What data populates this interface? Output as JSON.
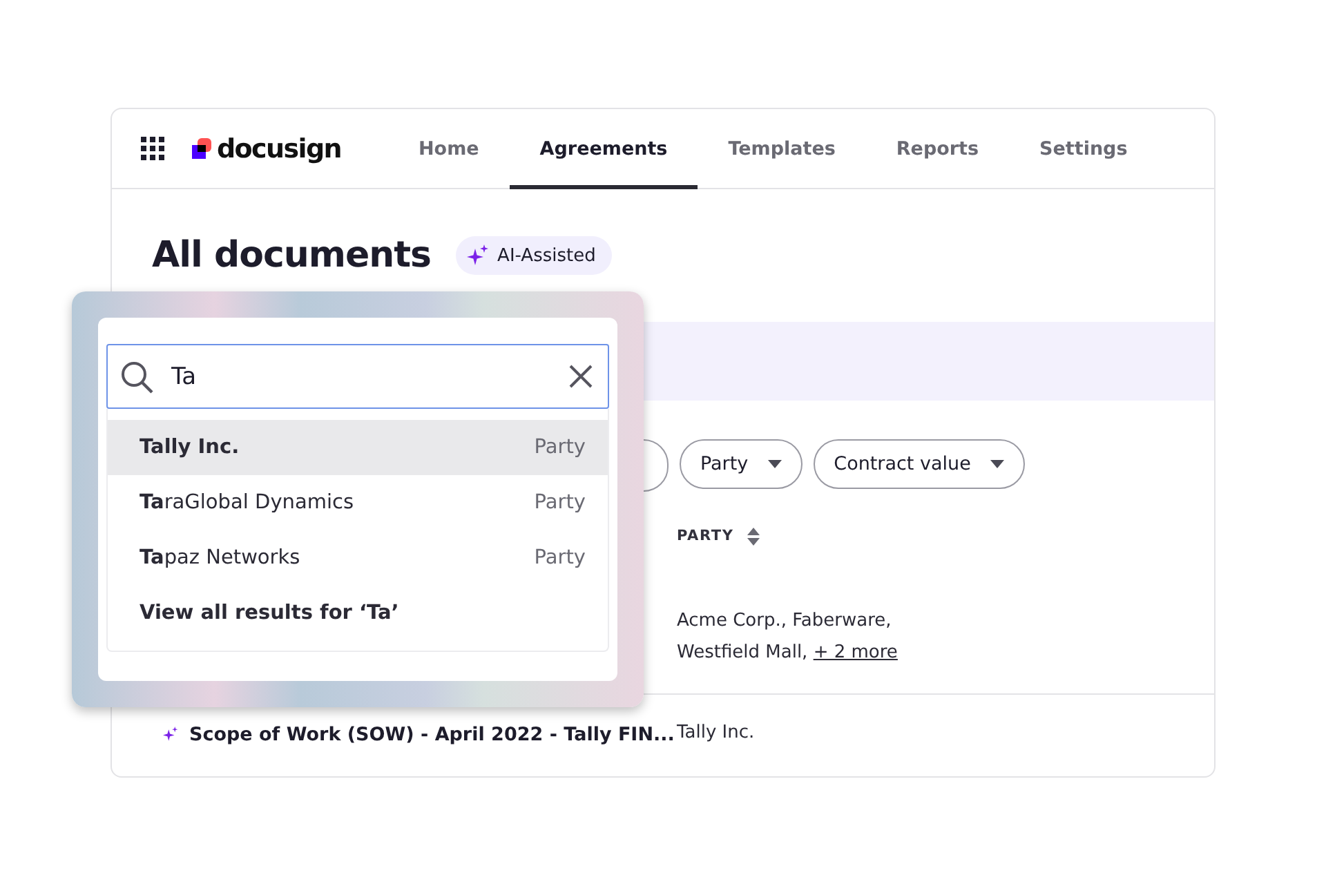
{
  "nav": {
    "logo": "docusign",
    "tabs": [
      {
        "label": "Home",
        "selected": false
      },
      {
        "label": "Agreements",
        "selected": true
      },
      {
        "label": "Templates",
        "selected": false
      },
      {
        "label": "Reports",
        "selected": false
      },
      {
        "label": "Settings",
        "selected": false
      }
    ]
  },
  "page": {
    "title": "All documents",
    "badge": "AI-Assisted"
  },
  "filters": [
    {
      "label": "Party"
    },
    {
      "label": "Contract value"
    }
  ],
  "table": {
    "columns": [
      "PARTY"
    ],
    "rows": [
      {
        "parties": "Acme Corp., Faberware, Westfield Mall,",
        "more": "+ 2 more"
      },
      {
        "name": "Scope of Work (SOW) - April 2022 - Tally FIN...",
        "ai": true,
        "parties": "Tally Inc."
      }
    ]
  },
  "search": {
    "value": "Ta",
    "suggestions": [
      {
        "label": "**Ta**lly Inc.",
        "type": "Party",
        "selected": true
      },
      {
        "label": "**Ta**raGlobal Dynamics",
        "type": "Party",
        "selected": false
      },
      {
        "label": "**Ta**paz Networks",
        "type": "Party",
        "selected": false
      }
    ],
    "view_all": "View all results for ‘Ta’"
  }
}
